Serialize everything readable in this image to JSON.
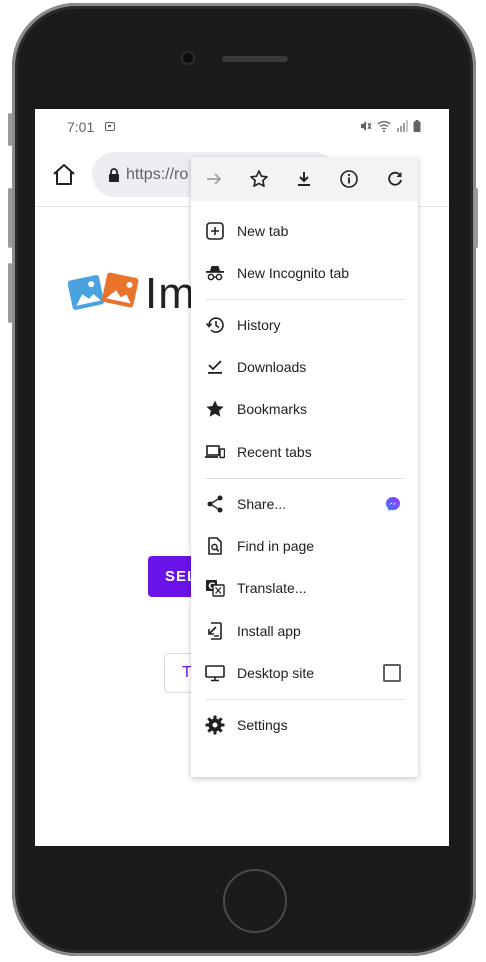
{
  "status_bar": {
    "time": "7:01"
  },
  "browser": {
    "url": "https://ro"
  },
  "page": {
    "logo_text": "Im",
    "primary_button": "SEL",
    "secondary_button": "T"
  },
  "menu": {
    "icon_bar": [
      {
        "icon": "forward-arrow-icon"
      },
      {
        "icon": "star-outline-icon"
      },
      {
        "icon": "download-icon"
      },
      {
        "icon": "info-icon"
      },
      {
        "icon": "refresh-icon"
      }
    ],
    "items": [
      {
        "label": "New tab",
        "icon": "new-tab-icon"
      },
      {
        "label": "New Incognito tab",
        "icon": "incognito-icon"
      },
      {
        "label": "History",
        "icon": "history-icon"
      },
      {
        "label": "Downloads",
        "icon": "downloads-icon"
      },
      {
        "label": "Bookmarks",
        "icon": "bookmark-star-icon"
      },
      {
        "label": "Recent tabs",
        "icon": "recent-tabs-icon"
      },
      {
        "label": "Share...",
        "icon": "share-icon"
      },
      {
        "label": "Find in page",
        "icon": "find-in-page-icon"
      },
      {
        "label": "Translate...",
        "icon": "translate-icon"
      },
      {
        "label": "Install app",
        "icon": "install-app-icon"
      },
      {
        "label": "Desktop site",
        "icon": "desktop-icon"
      },
      {
        "label": "Settings",
        "icon": "gear-icon"
      }
    ]
  },
  "colors": {
    "accent_purple": "#6a13e8",
    "messenger_blue": "#2f7bff",
    "messenger_purple": "#a334fa"
  }
}
